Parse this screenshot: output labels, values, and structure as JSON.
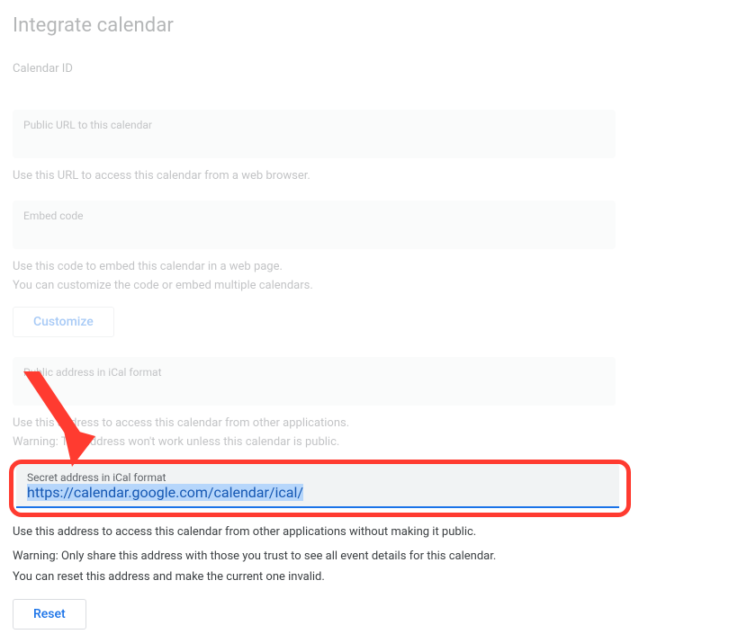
{
  "section": {
    "title": "Integrate calendar",
    "calendar_id_label": "Calendar ID"
  },
  "public_url": {
    "label": "Public URL to this calendar",
    "help": "Use this URL to access this calendar from a web browser."
  },
  "embed": {
    "label": "Embed code",
    "help1": "Use this code to embed this calendar in a web page.",
    "help2": "You can customize the code or embed multiple calendars.",
    "customize_btn": "Customize"
  },
  "public_ical": {
    "label": "Public address in iCal format",
    "help1": "Use this address to access this calendar from other applications.",
    "help2": "Warning: The address won't work unless this calendar is public."
  },
  "secret_ical": {
    "label": "Secret address in iCal format",
    "value": "https://calendar.google.com/calendar/ical/",
    "help1": "Use this address to access this calendar from other applications without making it public.",
    "help2": "Warning: Only share this address with those you trust to see all event details for this calendar.",
    "help3": "You can reset this address and make the current one invalid.",
    "reset_btn": "Reset"
  }
}
